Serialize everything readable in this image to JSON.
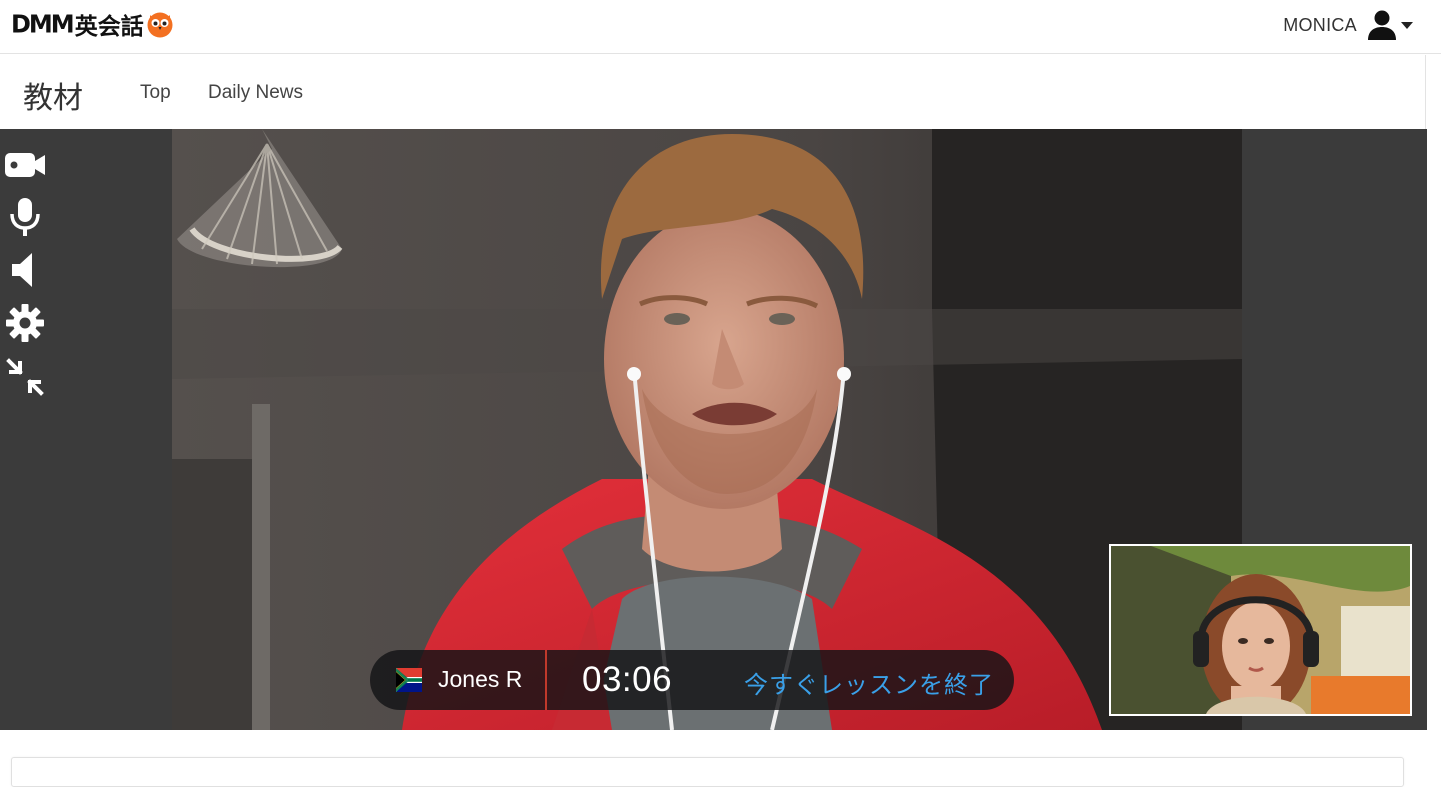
{
  "header": {
    "logo_text": "DMM",
    "logo_text_jp": "英会話",
    "user_name": "MONICA"
  },
  "subnav": {
    "title": "教材",
    "links": [
      "Top",
      "Daily News"
    ]
  },
  "toolbar": {
    "icons": [
      "video-camera-icon",
      "microphone-icon",
      "speaker-icon",
      "settings-gear-icon",
      "minimize-icon"
    ]
  },
  "lesson": {
    "tutor_name": "Jones R",
    "tutor_flag": "south-africa-flag",
    "timer": "03:06",
    "end_label": "今すぐレッスンを終了",
    "end_color": "#3aa0e8",
    "divider_color": "#c0392b"
  },
  "colors": {
    "brand_orange": "#f37021",
    "stage_bg": "#3b3b3b"
  }
}
